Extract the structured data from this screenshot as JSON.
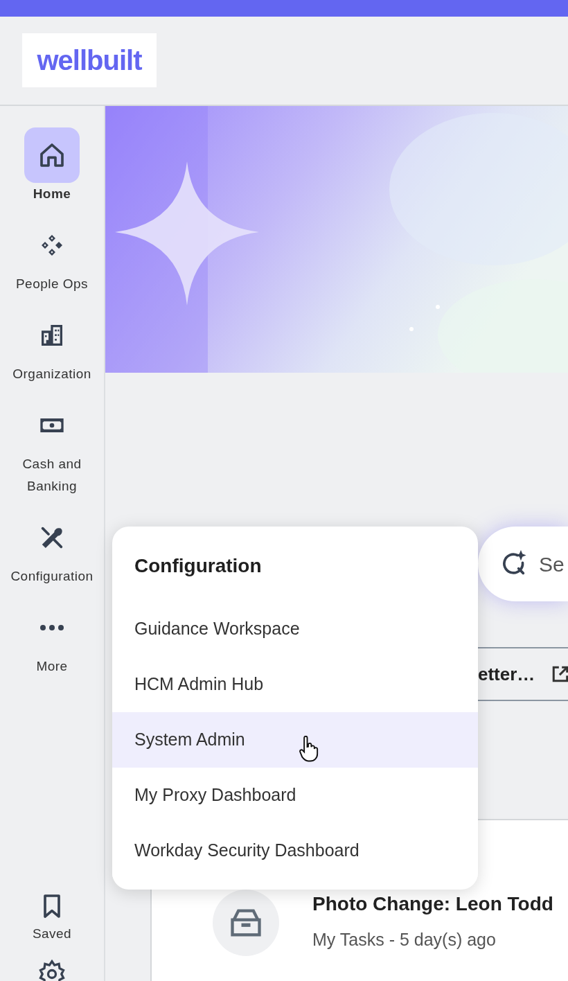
{
  "header": {
    "logo": "wellbuilt"
  },
  "sidebar": {
    "items": [
      {
        "label": "Home",
        "selected": true
      },
      {
        "label": "People Ops",
        "selected": false
      },
      {
        "label": "Organization",
        "selected": false
      },
      {
        "label": "Cash and Banking",
        "selected": false
      },
      {
        "label": "Configuration",
        "selected": false
      },
      {
        "label": "More",
        "selected": false
      }
    ],
    "bottom_items": [
      {
        "label": "Saved"
      }
    ]
  },
  "search": {
    "placeholder": "Se"
  },
  "card": {
    "title": "etter…"
  },
  "task": {
    "title": "Photo Change: Leon Todd",
    "subtitle": "My Tasks - 5 day(s) ago"
  },
  "menu": {
    "title": "Configuration",
    "items": [
      {
        "label": "Guidance Workspace",
        "selected": false
      },
      {
        "label": "HCM Admin Hub",
        "selected": false
      },
      {
        "label": "System Admin",
        "selected": true
      },
      {
        "label": "My Proxy Dashboard",
        "selected": false
      },
      {
        "label": "Workday Security Dashboard",
        "selected": false
      }
    ]
  }
}
